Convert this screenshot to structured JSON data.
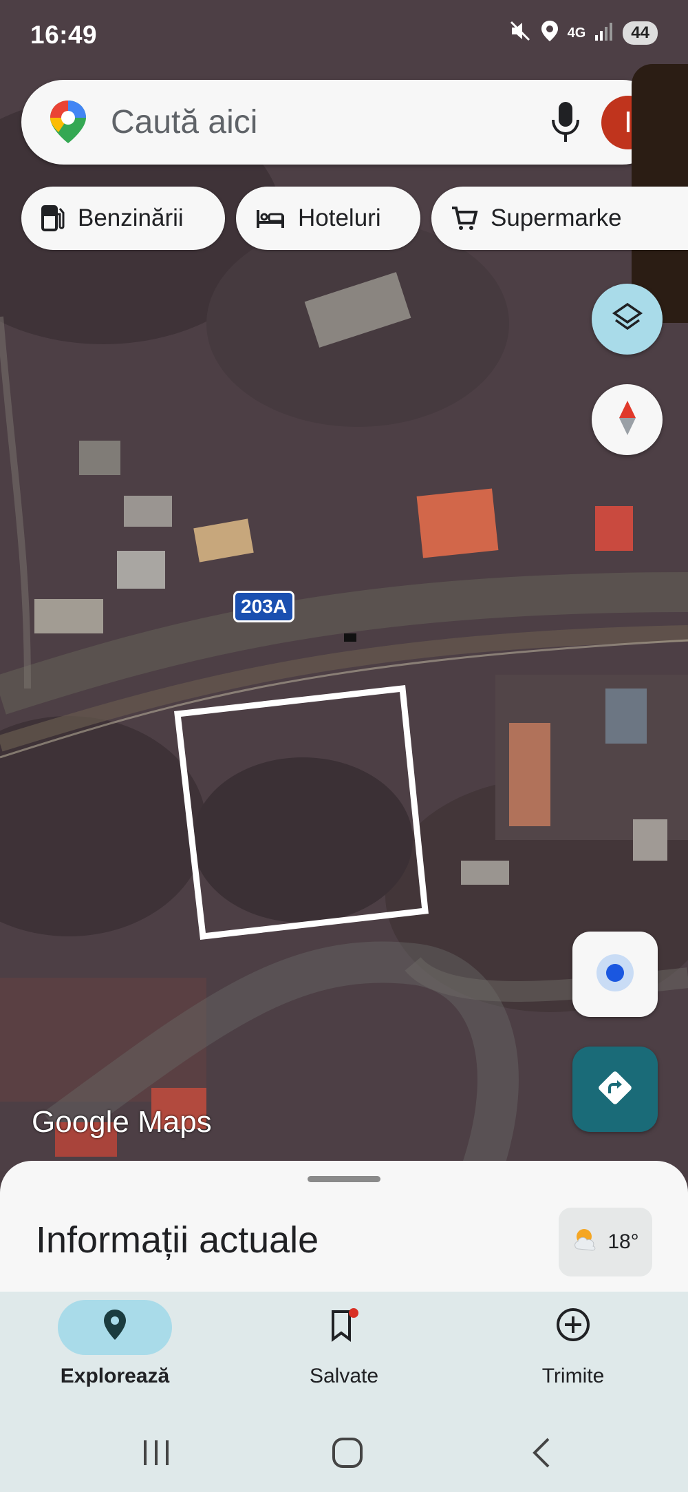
{
  "status_bar": {
    "time": "16:49",
    "network": "4G",
    "battery": "44"
  },
  "search": {
    "placeholder": "Caută aici",
    "avatar_initial": "I"
  },
  "chips": [
    {
      "label": "Benzinării",
      "icon": "gas-station-icon"
    },
    {
      "label": "Hoteluri",
      "icon": "bed-icon"
    },
    {
      "label": "Supermarke",
      "icon": "cart-icon"
    }
  ],
  "map": {
    "route_label": "203A",
    "attribution": "Google Maps"
  },
  "sheet": {
    "title": "Informații actuale",
    "temperature": "18°"
  },
  "bottom_nav": [
    {
      "label": "Explorează",
      "icon": "location-pin-icon",
      "active": true
    },
    {
      "label": "Salvate",
      "icon": "bookmark-icon",
      "active": false
    },
    {
      "label": "Trimite",
      "icon": "add-circle-icon",
      "active": false
    }
  ],
  "colors": {
    "accent_teal": "#1a6b78",
    "nav_bg": "#dfe9ea",
    "active_pill": "#a9dbe9",
    "location_dot": "#1a57e0"
  }
}
